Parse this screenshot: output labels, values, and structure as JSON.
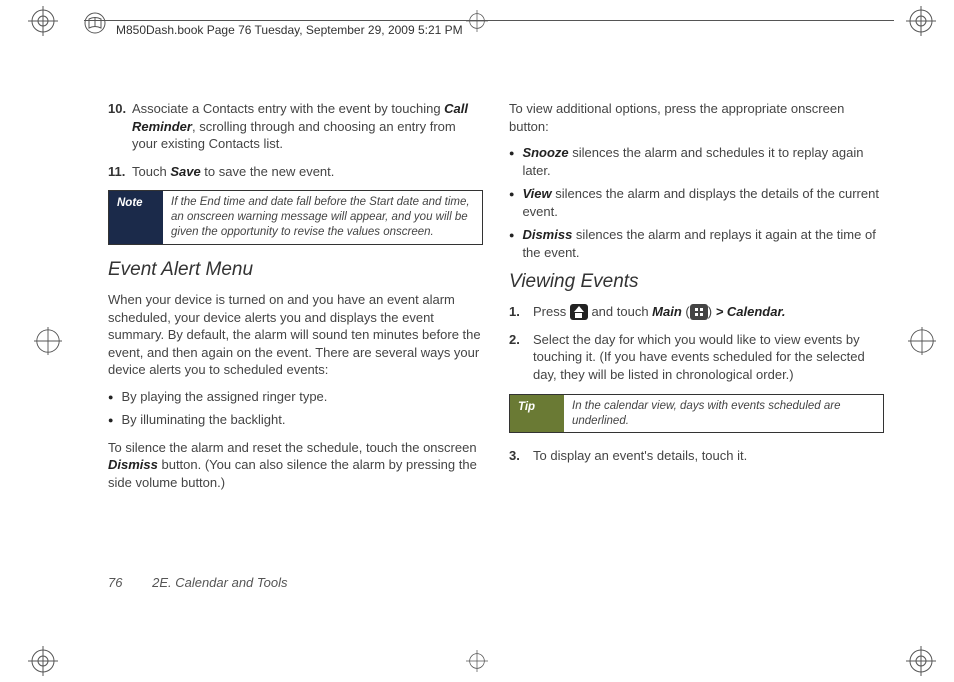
{
  "header": {
    "runline": "M850Dash.book  Page 76  Tuesday, September 29, 2009  5:21 PM"
  },
  "left": {
    "step10_num": "10.",
    "step10_text_a": "Associate a Contacts entry with the event by touching ",
    "step10_bold": "Call Reminder",
    "step10_text_b": ", scrolling through and choosing an entry from your existing Contacts list.",
    "step11_num": "11.",
    "step11_text_a": "Touch ",
    "step11_bold": "Save",
    "step11_text_b": " to save the new event.",
    "note_label": "Note",
    "note_body": "If the End time and date fall before the Start date and time, an onscreen warning message will appear, and you will be given the opportunity to revise the values onscreen.",
    "heading": "Event Alert Menu",
    "para1": "When your device is turned on and you have an event alarm scheduled, your device alerts you and displays the event summary. By default, the alarm will sound ten minutes before the event, and then again on the event. There are several ways your device alerts you to scheduled events:",
    "bullet1": "By playing the assigned ringer type.",
    "bullet2": "By illuminating the backlight.",
    "para2_a": "To silence the alarm and reset the schedule, touch the onscreen ",
    "para2_bold": "Dismiss",
    "para2_b": " button. (You can also silence the alarm by pressing the side volume button.)"
  },
  "right": {
    "intro": "To view additional options, press the appropriate onscreen button:",
    "opt1_bold": "Snooze",
    "opt1_text": " silences the alarm and schedules it to replay again later.",
    "opt2_bold": "View",
    "opt2_text": " silences the alarm and displays the details of the current event.",
    "opt3_bold": "Dismiss",
    "opt3_text": " silences the alarm and replays it again at the time of the event.",
    "heading": "Viewing Events",
    "step1_num": "1.",
    "step1_a": "Press ",
    "step1_b": " and touch ",
    "step1_main": "Main",
    "step1_paren_open": " (",
    "step1_paren_close": ") ",
    "step1_gt": ">",
    "step1_cal": " Calendar.",
    "step2_num": "2.",
    "step2_text": "Select the day for which you would like to view events by touching it. (If you have events scheduled for the selected day, they will be listed in chronological order.)",
    "tip_label": "Tip",
    "tip_body": "In the calendar view, days with events scheduled are underlined.",
    "step3_num": "3.",
    "step3_text": "To display an event's details, touch it."
  },
  "footer": {
    "page": "76",
    "section": "2E. Calendar and Tools"
  }
}
